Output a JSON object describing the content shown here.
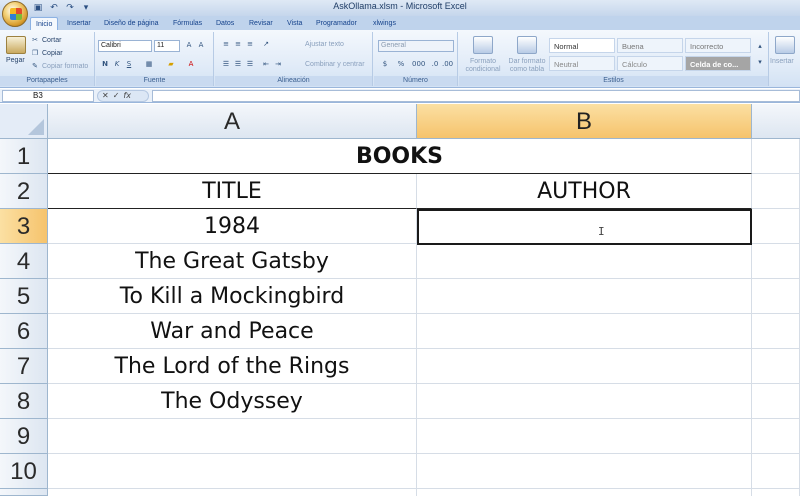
{
  "window": {
    "title": "AskOllama.xlsm - Microsoft Excel"
  },
  "ribbon": {
    "tabs": [
      "Inicio",
      "Insertar",
      "Diseño de página",
      "Fórmulas",
      "Datos",
      "Revisar",
      "Vista",
      "Programador",
      "xlwings"
    ],
    "active_tab": "Inicio",
    "clipboard": {
      "paste": "Pegar",
      "cut": "Cortar",
      "copy": "Copiar",
      "format_painter": "Copiar formato",
      "label": "Portapapeles"
    },
    "font": {
      "name": "Calibri",
      "size": "11",
      "bold": "N",
      "italic": "K",
      "underline": "S",
      "label": "Fuente"
    },
    "alignment": {
      "wrap": "Ajustar texto",
      "merge": "Combinar y centrar",
      "label": "Alineación"
    },
    "number": {
      "format": "General",
      "label": "Número"
    },
    "styles": {
      "conditional": "Formato condicional",
      "as_table": "Dar formato como tabla",
      "normal": "Normal",
      "good": "Buena",
      "bad": "Incorrecto",
      "neutral": "Neutral",
      "calc": "Cálculo",
      "check_cell": "Celda de co...",
      "label": "Estilos"
    },
    "cells": {
      "insert": "Insertar"
    }
  },
  "formula_bar": {
    "name_box": "B3",
    "fx": "fx",
    "value": ""
  },
  "grid": {
    "columns": [
      "A",
      "B"
    ],
    "selected_column": "B",
    "rows": [
      "1",
      "2",
      "3",
      "4",
      "5",
      "6",
      "7",
      "8",
      "9",
      "10"
    ],
    "selected_row": "3",
    "cells": {
      "r1": {
        "merged": "BOOKS"
      },
      "r2": {
        "a": "TITLE",
        "b": "AUTHOR"
      },
      "r3": {
        "a": "1984",
        "b": ""
      },
      "r4": {
        "a": "The Great Gatsby",
        "b": ""
      },
      "r5": {
        "a": "To Kill a Mockingbird",
        "b": ""
      },
      "r6": {
        "a": "War and Peace",
        "b": ""
      },
      "r7": {
        "a": "The Lord of the Rings",
        "b": ""
      },
      "r8": {
        "a": "The Odyssey",
        "b": ""
      }
    }
  },
  "colors": {
    "selection_header": "#f6c36c",
    "ribbon": "#dfe9f5",
    "accent": "#15428b"
  }
}
